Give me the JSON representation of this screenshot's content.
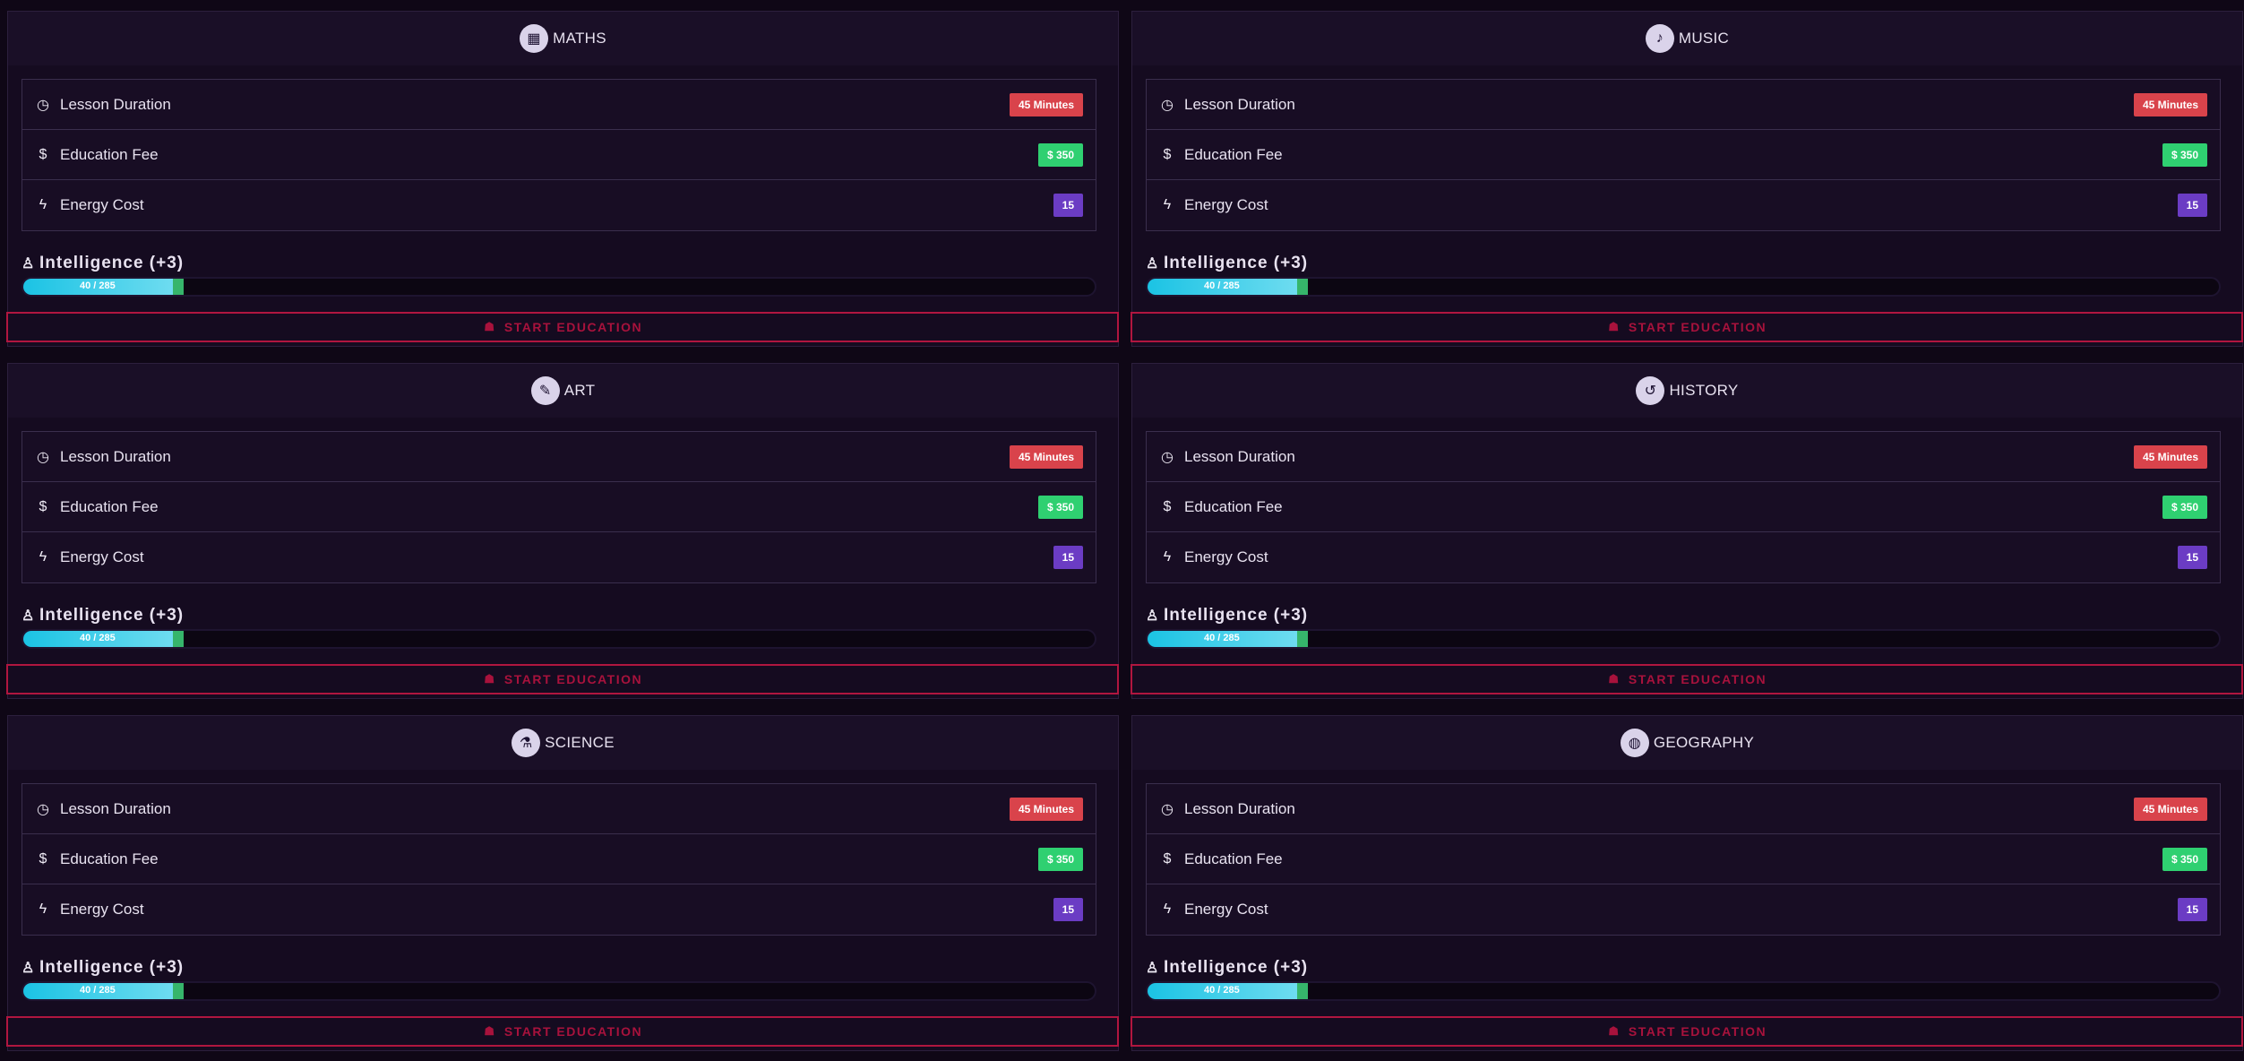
{
  "rows_labels": {
    "duration": "Lesson Duration",
    "fee": "Education Fee",
    "energy": "Energy Cost"
  },
  "courses": [
    {
      "title": "MATHS",
      "icon": "calculator-icon",
      "glyph": "▦",
      "duration": "45 Minutes",
      "fee": "$ 350",
      "energy": "15",
      "stat": "Intelligence (+3)",
      "progress_text": "40 / 285",
      "progress": 0.14,
      "button": "START EDUCATION"
    },
    {
      "title": "MUSIC",
      "icon": "music-icon",
      "glyph": "♪",
      "duration": "45 Minutes",
      "fee": "$ 350",
      "energy": "15",
      "stat": "Intelligence (+3)",
      "progress_text": "40 / 285",
      "progress": 0.14,
      "button": "START EDUCATION"
    },
    {
      "title": "ART",
      "icon": "brush-icon",
      "glyph": "✎",
      "duration": "45 Minutes",
      "fee": "$ 350",
      "energy": "15",
      "stat": "Intelligence (+3)",
      "progress_text": "40 / 285",
      "progress": 0.14,
      "button": "START EDUCATION"
    },
    {
      "title": "HISTORY",
      "icon": "history-icon",
      "glyph": "↺",
      "duration": "45 Minutes",
      "fee": "$ 350",
      "energy": "15",
      "stat": "Intelligence (+3)",
      "progress_text": "40 / 285",
      "progress": 0.14,
      "button": "START EDUCATION"
    },
    {
      "title": "SCIENCE",
      "icon": "flask-icon",
      "glyph": "⚗",
      "duration": "45 Minutes",
      "fee": "$ 350",
      "energy": "15",
      "stat": "Intelligence (+3)",
      "progress_text": "40 / 285",
      "progress": 0.14,
      "button": "START EDUCATION"
    },
    {
      "title": "GEOGRAPHY",
      "icon": "globe-icon",
      "glyph": "◍",
      "duration": "45 Minutes",
      "fee": "$ 350",
      "energy": "15",
      "stat": "Intelligence (+3)",
      "progress_text": "40 / 285",
      "progress": 0.14,
      "button": "START EDUCATION"
    }
  ],
  "colors": {
    "duration_badge": "#d9434b",
    "fee_badge": "#2fd071",
    "energy_badge": "#6b3cc4",
    "button_accent": "#b0163f",
    "progress_fill": "#1bc3e4"
  }
}
